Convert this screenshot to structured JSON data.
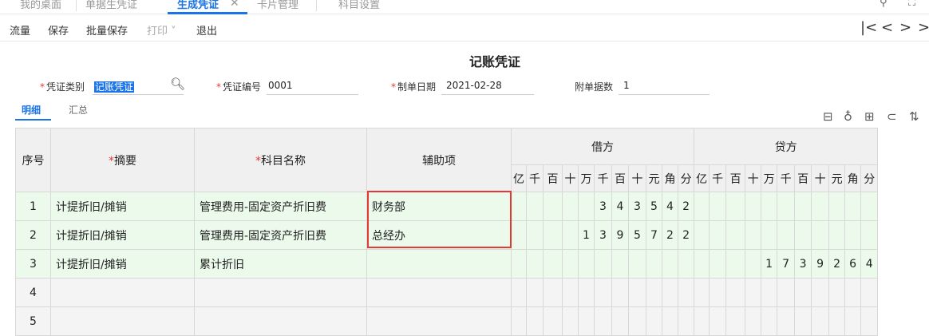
{
  "tabs": [
    {
      "label": "我的桌面"
    },
    {
      "label": "单据生凭证"
    },
    {
      "label": "生成凭证"
    },
    {
      "label": "卡片管理"
    },
    {
      "label": "科目设置"
    }
  ],
  "toolbar": {
    "flow": "流量",
    "save": "保存",
    "batch_save": "批量保存",
    "print": "打印",
    "exit": "退出",
    "nav": {
      "first": "|<",
      "prev": "<",
      "next": ">",
      "last": ">|"
    }
  },
  "voucher": {
    "title": "记账凭证",
    "type_label": "凭证类别",
    "type_value": "记账凭证",
    "no_label": "凭证编号",
    "no_value": "0001",
    "date_label": "制单日期",
    "date_value": "2021-02-28",
    "attach_label": "附单据数",
    "attach_value": "1"
  },
  "subtabs": {
    "detail": "明细",
    "summary": "汇总"
  },
  "table": {
    "headers": {
      "seq": "序号",
      "summary": "摘要",
      "account": "科目名称",
      "aux": "辅助项",
      "debit": "借方",
      "credit": "贷方",
      "units": [
        "亿",
        "千",
        "百",
        "十",
        "万",
        "千",
        "百",
        "十",
        "元",
        "角",
        "分"
      ]
    },
    "rows": [
      {
        "seq": "1",
        "summary": "计提折旧/摊销",
        "account": "管理费用-固定资产折旧费",
        "aux": "财务部",
        "debit": [
          "",
          "",
          "",
          "",
          "",
          "3",
          "4",
          "3",
          "5",
          "4",
          "2"
        ],
        "credit": [
          "",
          "",
          "",
          "",
          "",
          "",
          "",
          "",
          "",
          "",
          ""
        ]
      },
      {
        "seq": "2",
        "summary": "计提折旧/摊销",
        "account": "管理费用-固定资产折旧费",
        "aux": "总经办",
        "debit": [
          "",
          "",
          "",
          "",
          "1",
          "3",
          "9",
          "5",
          "7",
          "2",
          "2"
        ],
        "credit": [
          "",
          "",
          "",
          "",
          "",
          "",
          "",
          "",
          "",
          "",
          ""
        ]
      },
      {
        "seq": "3",
        "summary": "计提折旧/摊销",
        "account": "累计折旧",
        "aux": "",
        "debit": [
          "",
          "",
          "",
          "",
          "",
          "",
          "",
          "",
          "",
          "",
          ""
        ],
        "credit": [
          "",
          "",
          "",
          "",
          "1",
          "7",
          "3",
          "9",
          "2",
          "6",
          "4"
        ]
      }
    ],
    "empty_rows": [
      "4",
      "5"
    ]
  },
  "colors": {
    "accent": "#1a73e8",
    "required": "#e53935",
    "row_bg": "#ebfaeb",
    "highlight_box": "#e53935"
  }
}
